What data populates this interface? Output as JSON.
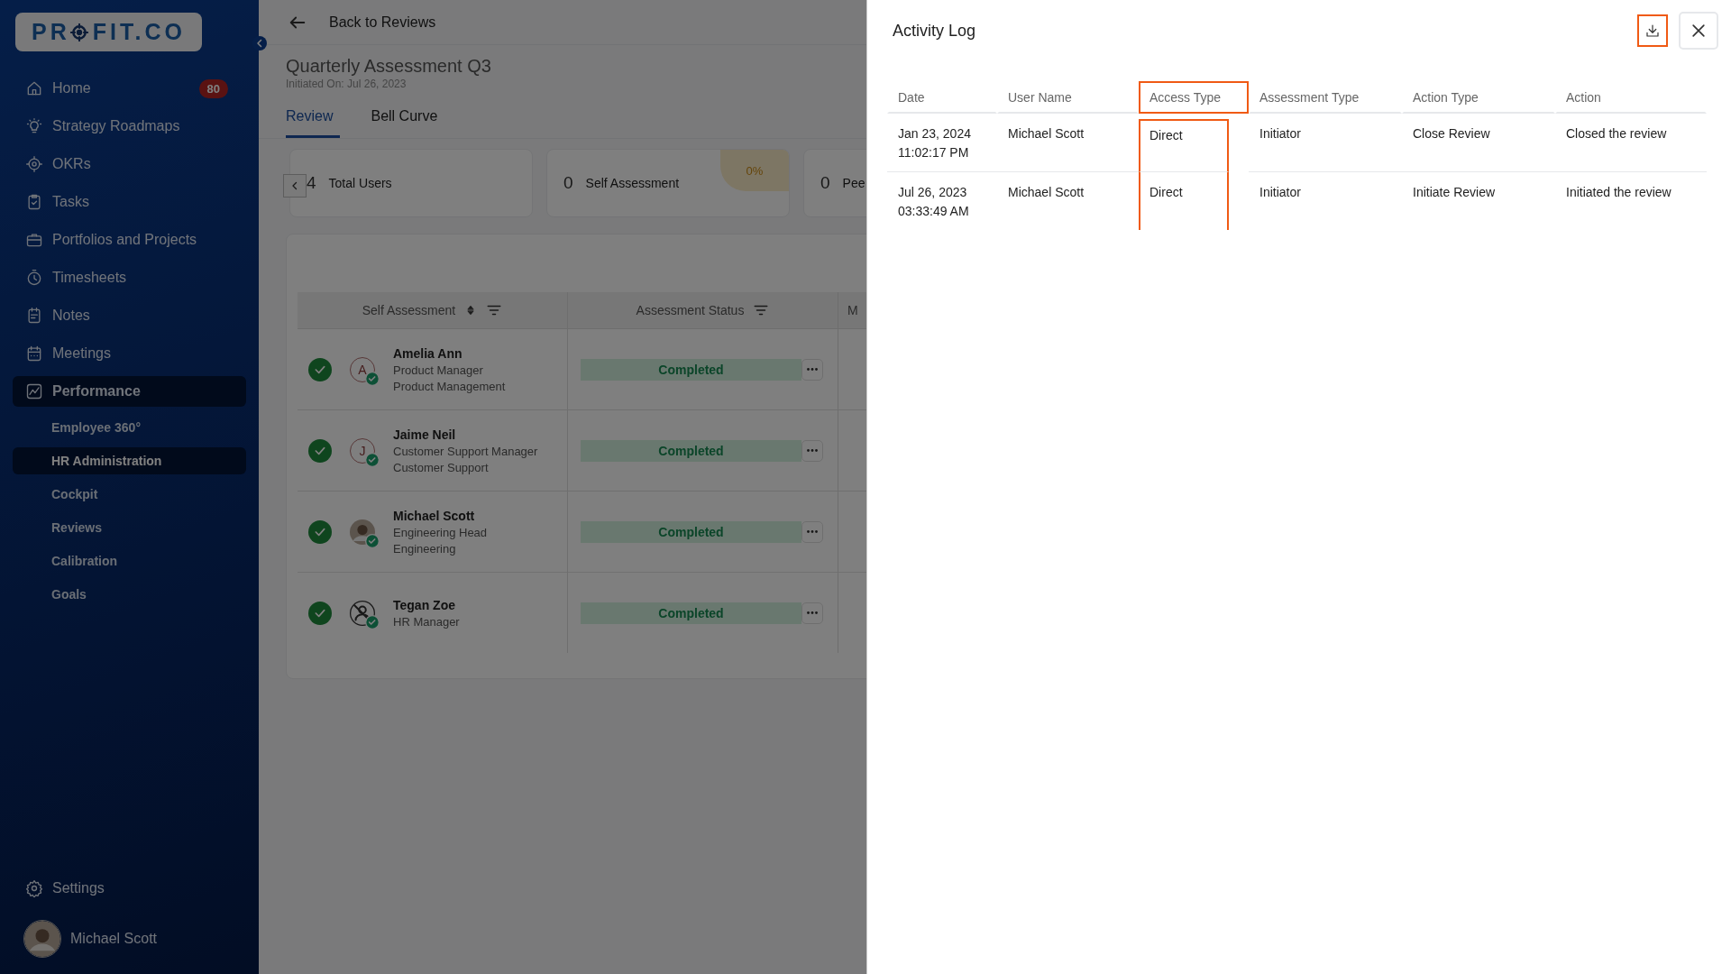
{
  "sidebar": {
    "logo": [
      "PR",
      "FIT.CO"
    ],
    "items": [
      {
        "label": "Home",
        "badge": "80",
        "selected": false
      },
      {
        "label": "Strategy Roadmaps",
        "selected": false
      },
      {
        "label": "OKRs",
        "selected": false
      },
      {
        "label": "Tasks",
        "selected": false
      },
      {
        "label": "Portfolios and Projects",
        "selected": false
      },
      {
        "label": "Timesheets",
        "selected": false
      },
      {
        "label": "Notes",
        "selected": false
      },
      {
        "label": "Meetings",
        "selected": false
      },
      {
        "label": "Performance",
        "selected": true,
        "children": [
          {
            "label": "Employee 360°",
            "selected": false
          },
          {
            "label": "HR Administration",
            "selected": true
          },
          {
            "label": "Cockpit",
            "selected": false
          },
          {
            "label": "Reviews",
            "selected": false
          },
          {
            "label": "Calibration",
            "selected": false
          },
          {
            "label": "Goals",
            "selected": false
          }
        ]
      }
    ],
    "settings": "Settings",
    "user": "Michael Scott"
  },
  "main": {
    "back_link": "Back to Reviews",
    "title": "Quarterly Assessment Q3",
    "subtitle": "Initiated On: Jul 26, 2023",
    "tabs": [
      {
        "label": "Review",
        "selected": true
      },
      {
        "label": "Bell Curve",
        "selected": false
      }
    ],
    "stat_cards": [
      {
        "value": "4",
        "label": "Total Users"
      },
      {
        "value": "0",
        "label": "Self Assessment",
        "percent": "0%"
      },
      {
        "value": "0",
        "label": "Pee"
      }
    ],
    "table": {
      "columns": [
        {
          "label": "Self Assessment",
          "sortable": true,
          "filterable": true
        },
        {
          "label": "Assessment Status",
          "filterable": true
        },
        {
          "label": "M"
        }
      ],
      "rows": [
        {
          "name": "Amelia Ann",
          "lines": [
            "Product Manager",
            "Product Management"
          ],
          "avatar": {
            "kind": "letter",
            "text": "A"
          },
          "done": true,
          "status": "Completed"
        },
        {
          "name": "Jaime Neil",
          "lines": [
            "Customer Support Manager",
            "Customer Support"
          ],
          "avatar": {
            "kind": "letter",
            "text": "J"
          },
          "done": true,
          "status": "Completed"
        },
        {
          "name": "Michael Scott",
          "lines": [
            "Engineering Head",
            "Engineering"
          ],
          "avatar": {
            "kind": "photo"
          },
          "done": true,
          "status": "Completed"
        },
        {
          "name": "Tegan Zoe",
          "lines": [
            "HR Manager"
          ],
          "avatar": {
            "kind": "none"
          },
          "done": true,
          "status": "Completed"
        }
      ]
    }
  },
  "drawer": {
    "title": "Activity Log",
    "download": {
      "highlighted": true
    },
    "columns": [
      {
        "label": "Date",
        "highlighted": false
      },
      {
        "label": "User Name",
        "highlighted": false
      },
      {
        "label": "Access Type",
        "highlighted": true
      },
      {
        "label": "Assessment Type",
        "highlighted": false
      },
      {
        "label": "Action Type",
        "highlighted": false
      },
      {
        "label": "Action",
        "highlighted": false
      }
    ],
    "rows": [
      [
        "Jan 23, 2024\n11:02:17 PM",
        "Michael Scott",
        "Direct",
        "Initiator",
        "Close Review",
        "Closed the review"
      ],
      [
        "Jul 26, 2023\n03:33:49 AM",
        "Michael Scott",
        "Direct",
        "Initiator",
        "Initiate Review",
        "Initiated the review"
      ]
    ]
  }
}
